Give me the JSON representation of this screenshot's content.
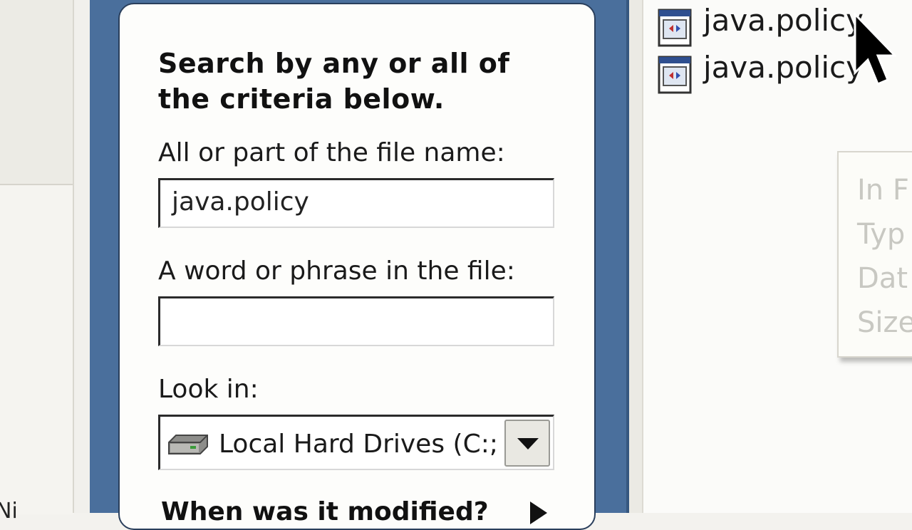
{
  "left_strip": {
    "partial_text": "Ni"
  },
  "search_panel": {
    "heading_line1": "Search by any or all of",
    "heading_line2": "the criteria below.",
    "filename_label": "All or part of the file name:",
    "filename_value": "java.policy",
    "phrase_label": "A word or phrase in the file:",
    "phrase_value": "",
    "lookin_label": "Look in:",
    "lookin_value": "Local Hard Drives (C:;",
    "section_title": "When was it modified?"
  },
  "results": {
    "files": [
      {
        "name": "java.policy",
        "icon": "policy-file-icon"
      },
      {
        "name": "java.policy",
        "icon": "policy-file-icon"
      }
    ]
  },
  "tooltip": {
    "lines": [
      "In F",
      "Typ",
      "Dat",
      "Size"
    ]
  },
  "icons": {
    "drive": "hard-drive-icon",
    "dropdown": "chevron-down-icon",
    "cursor": "mouse-pointer-icon"
  },
  "colors": {
    "panel_blue": "#4a6f9c",
    "card_bg": "#fdfdfb"
  }
}
